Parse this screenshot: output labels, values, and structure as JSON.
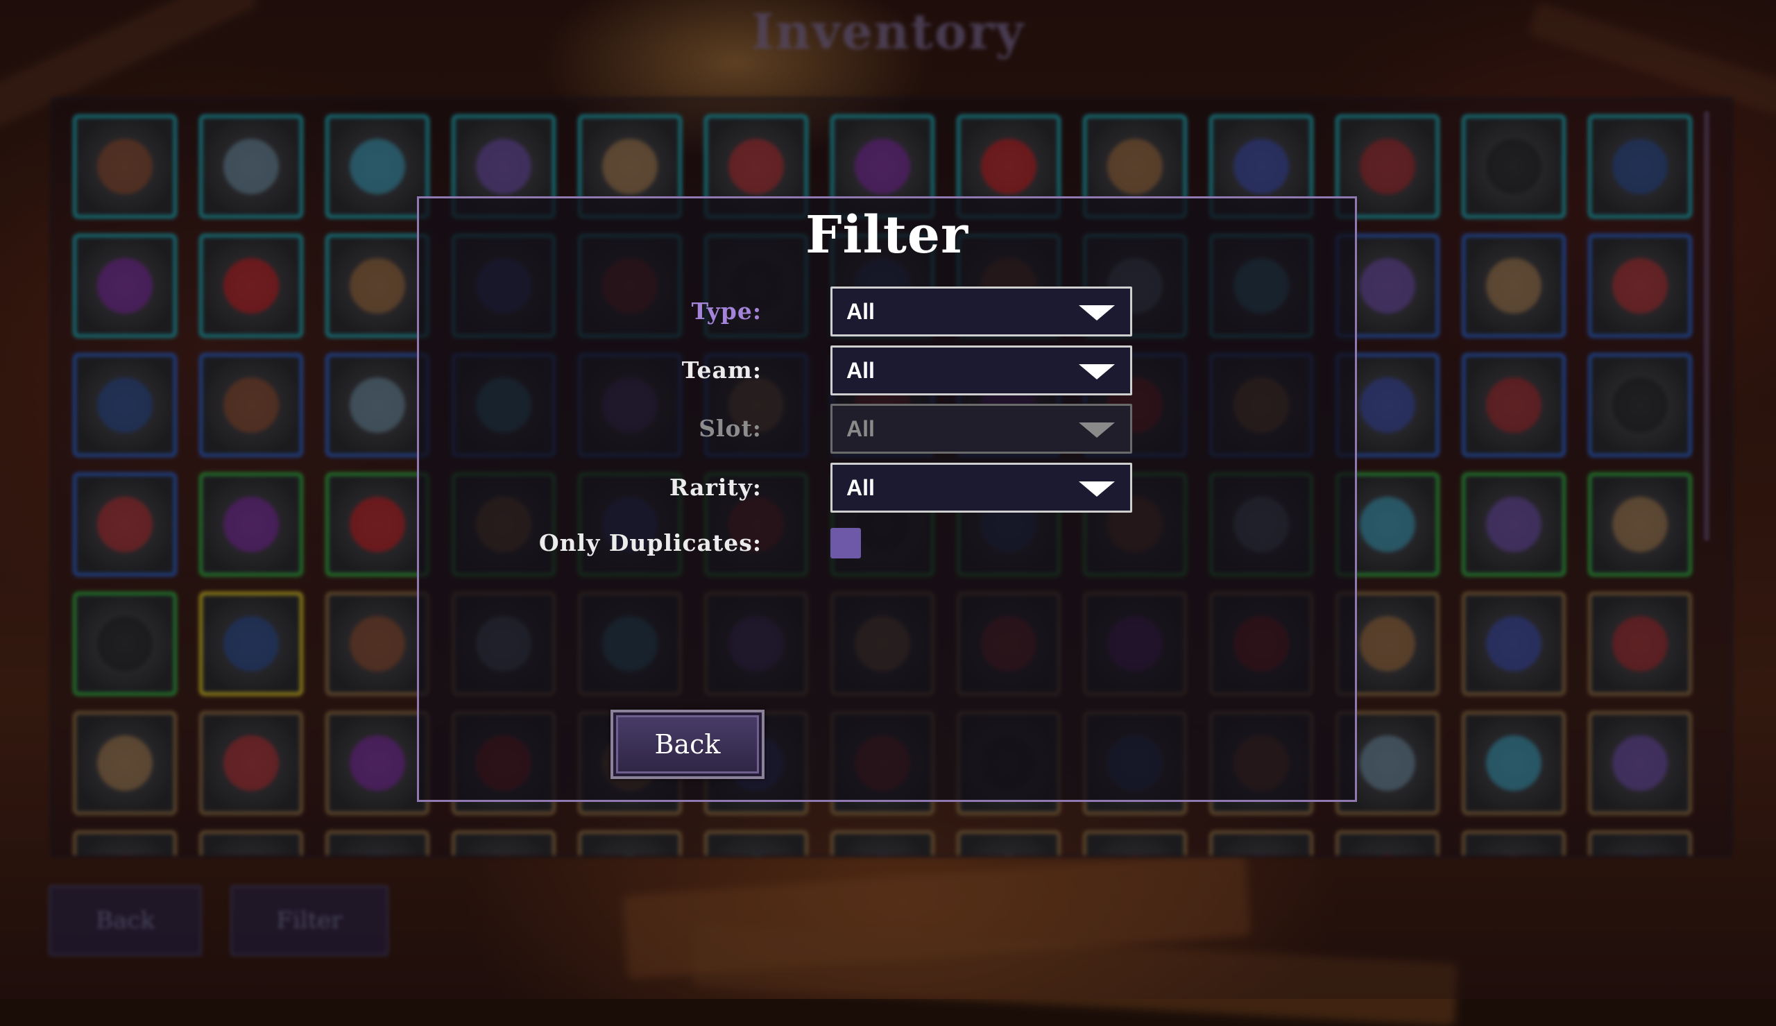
{
  "background": {
    "title": "Inventory",
    "bottom_buttons": {
      "back_label": "Back",
      "filter_label": "Filter"
    },
    "grid_rows": [
      [
        "#1ca9b0",
        "#1ca9b0",
        "#1ca9b0",
        "#1ca9b0",
        "#1ca9b0",
        "#1ca9b0",
        "#1ca9b0",
        "#1ca9b0",
        "#1ca9b0",
        "#1ca9b0",
        "#1ca9b0",
        "#1ca9b0",
        "#1ca9b0"
      ],
      [
        "#1ca9b0",
        "#1ca9b0",
        "#1ca9b0",
        "#1ca9b0",
        "#1ca9b0",
        "#1ca9b0",
        "#1ca9b0",
        "#1ca9b0",
        "#1ca9b0",
        "#1ca9b0",
        "#2a5fc4",
        "#2a5fc4",
        "#2a5fc4"
      ],
      [
        "#2a5fc4",
        "#2a5fc4",
        "#2a5fc4",
        "#2a5fc4",
        "#2a5fc4",
        "#2a5fc4",
        "#2a5fc4",
        "#2a5fc4",
        "#2a5fc4",
        "#2a5fc4",
        "#2a5fc4",
        "#2a5fc4",
        "#2a5fc4"
      ],
      [
        "#2a5fc4",
        "#2fae3c",
        "#2fae3c",
        "#2fae3c",
        "#2fae3c",
        "#2fae3c",
        "#2fae3c",
        "#2fae3c",
        "#2fae3c",
        "#2fae3c",
        "#2fae3c",
        "#2fae3c",
        "#2fae3c"
      ],
      [
        "#2fae3c",
        "#d6c21e",
        "#8a6a3c",
        "#8a6a3c",
        "#8a6a3c",
        "#8a6a3c",
        "#8a6a3c",
        "#8a6a3c",
        "#8a6a3c",
        "#8a6a3c",
        "#8a6a3c",
        "#8a6a3c",
        "#8a6a3c"
      ],
      [
        "#8a6a3c",
        "#8a6a3c",
        "#8a6a3c",
        "#8a6a3c",
        "#8a6a3c",
        "#8a6a3c",
        "#8a6a3c",
        "#8a6a3c",
        "#8a6a3c",
        "#8a6a3c",
        "#8a6a3c",
        "#8a6a3c",
        "#8a6a3c"
      ],
      [
        "#8a6a3c",
        "#8a6a3c",
        "#8a6a3c",
        "#8a6a3c",
        "#8a6a3c",
        "#8a6a3c",
        "#8a6a3c",
        "#8a6a3c",
        "#8a6a3c",
        "#8a6a3c",
        "#8a6a3c",
        "#8a6a3c",
        "#8a6a3c"
      ]
    ]
  },
  "filter": {
    "title": "Filter",
    "type": {
      "label": "Type:",
      "value": "All"
    },
    "team": {
      "label": "Team:",
      "value": "All"
    },
    "slot": {
      "label": "Slot:",
      "value": "All"
    },
    "rarity": {
      "label": "Rarity:",
      "value": "All"
    },
    "only_duplicates": {
      "label": "Only Duplicates:",
      "checked": false
    },
    "back_label": "Back"
  },
  "colors": {
    "accent": "#8f79b0",
    "active_label": "#a384d8",
    "checkbox": "#6e58a8"
  }
}
